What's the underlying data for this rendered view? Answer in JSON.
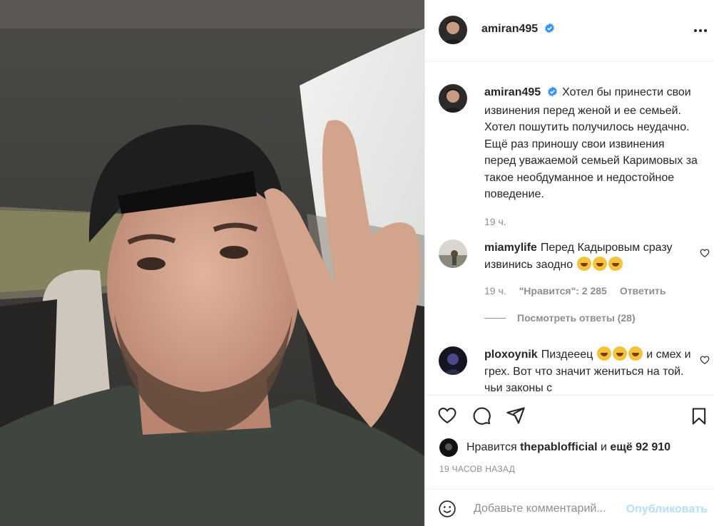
{
  "post": {
    "author": "amiran495",
    "verified": true,
    "photo_alt": "photo-selfie-in-car"
  },
  "caption": {
    "username": "amiran495",
    "text": "Хотел бы принести свои извинения перед женой и ее семьей. Хотел пошутить получилось неудачно. Ещё раз приношу свои извинения перед уважаемой семьей Каримовых за такое необдуманное и недостойное поведение.",
    "time": "19 ч."
  },
  "comments": [
    {
      "username": "miamylife",
      "text": "Перед Кадыровым сразу извинись заодно",
      "emoji_count": 3,
      "time": "19 ч.",
      "likes": "\"Нравится\": 2 285",
      "reply_label": "Ответить",
      "view_replies": "Посмотреть ответы (28)"
    },
    {
      "username": "ploxoynik",
      "text_before": "Пиздееец",
      "emoji_count": 3,
      "text_after": "и смех и грех. Вот что значит жениться на той. чьи законы с"
    }
  ],
  "likes": {
    "prefix": "Нравится",
    "user": "thepablofficial",
    "and": "и",
    "more": "ещё 92 910"
  },
  "posted_ago": "19 ЧАСОВ НАЗАД",
  "add_comment": {
    "placeholder": "Добавьте комментарий...",
    "post_label": "Опубликовать"
  },
  "colors": {
    "verified": "#3897f0",
    "post_button_disabled": "#b2dffc",
    "secondary_text": "#8e8e8e"
  }
}
